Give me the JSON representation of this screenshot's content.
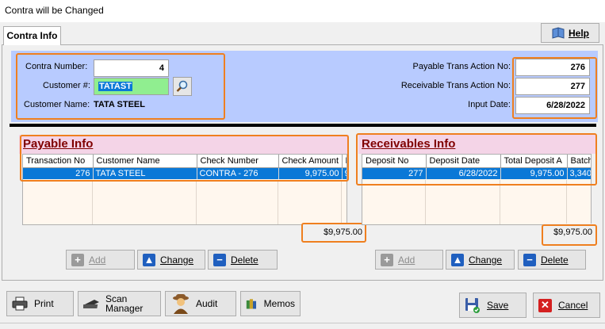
{
  "window": {
    "title": "Contra will be Changed"
  },
  "tabs": [
    {
      "label": "Contra Info"
    }
  ],
  "help": {
    "label": "Help"
  },
  "contra": {
    "number_label": "Contra Number:",
    "number_value": "4",
    "customer_label": "Customer #:",
    "customer_value": "TATAST",
    "customer_name_label": "Customer Name:",
    "customer_name_value": "TATA STEEL",
    "payable_trans_label": "Payable Trans Action No:",
    "payable_trans_value": "276",
    "receivable_trans_label": "Receivable Trans Action No:",
    "receivable_trans_value": "277",
    "input_date_label": "Input Date:",
    "input_date_value": "6/28/2022"
  },
  "payable": {
    "title": "Payable Info",
    "columns": [
      "Transaction No",
      "Customer Name",
      "Check Number",
      "Check Amount",
      "B"
    ],
    "rows": [
      [
        "276",
        "TATA STEEL",
        "CONTRA - 276",
        "9,975.00",
        "9"
      ]
    ],
    "total": "$9,975.00",
    "buttons": {
      "add": "Add",
      "change": "Change",
      "delete": "Delete"
    }
  },
  "receivables": {
    "title": "Receivables Info",
    "columns": [
      "Deposit No",
      "Deposit Date",
      "Total Deposit A",
      "Batch"
    ],
    "rows": [
      [
        "277",
        "6/28/2022",
        "9,975.00",
        "3,340"
      ]
    ],
    "total": "$9,975.00",
    "buttons": {
      "add": "Add",
      "change": "Change",
      "delete": "Delete"
    }
  },
  "footer": {
    "print": "Print",
    "scan_line1": "Scan",
    "scan_line2": "Manager",
    "audit": "Audit",
    "memos": "Memos",
    "save": "Save",
    "cancel": "Cancel"
  },
  "colors": {
    "highlight": "#ef7f1f",
    "header_band": "#b8cbff",
    "section_band": "#f4d4e7",
    "selection": "#0a78d7",
    "section_title": "#800000"
  }
}
